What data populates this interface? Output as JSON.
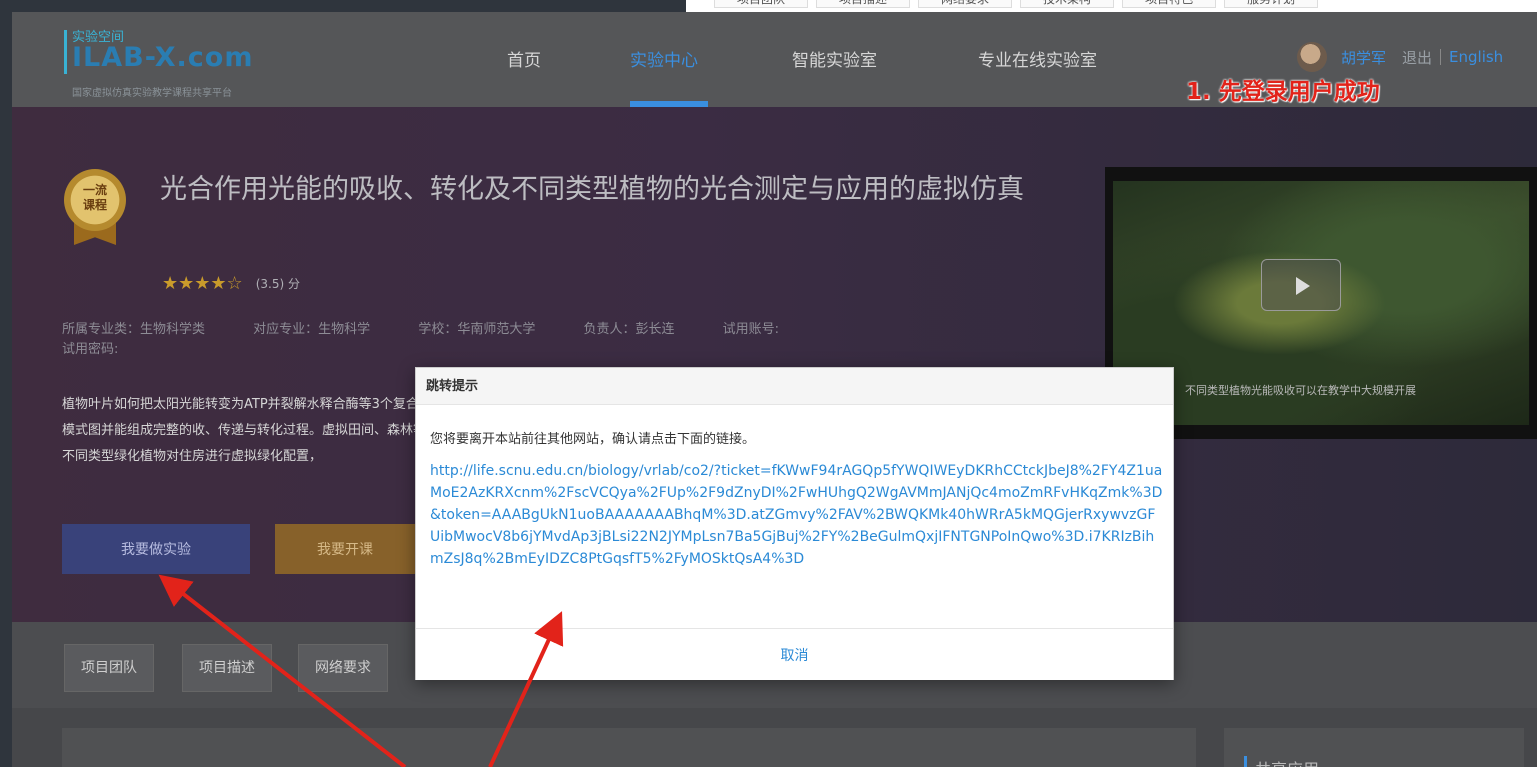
{
  "top_snippet": {
    "tabs": [
      "项目团队",
      "项目描述",
      "网络要求",
      "技术架构",
      "项目特色",
      "服务计划"
    ]
  },
  "header": {
    "logo_cn": "实验空间",
    "logo_en": "ILAB-X.com",
    "logo_sub": "国家虚拟仿真实验教学课程共享平台",
    "nav": [
      "首页",
      "实验中心",
      "智能实验室",
      "专业在线实验室"
    ],
    "active_nav": "实验中心",
    "user_name": "胡学军",
    "logout": "退出",
    "language": "English"
  },
  "annotations": {
    "login_note": "1. 先登录用户成功"
  },
  "hero": {
    "badge": "一流课程",
    "title": "光合作用光能的吸收、转化及不同类型植物的光合测定与应用的虚拟仿真",
    "rating_stars": "★★★★☆",
    "rating": "(3.5) 分",
    "meta": {
      "major_category": "所属专业类：生物科学类",
      "major": "对应专业：生物科学",
      "school": "学校：华南师范大学",
      "leader": "负责人：彭长连",
      "trial_account": "试用账号:",
      "trial_password": "试用密码:"
    },
    "description": "植物叶片如何把太阳光能转变为ATP并裂解水释合酶等3个复合体的三维模式图并能组成完整的收、传递与转化过程。虚拟田间、森林等野外场择不同类型绿化植物对住房进行虚拟绿化配置，",
    "buttons": {
      "do_experiment": "我要做实验",
      "teach": "我要开课"
    },
    "video_caption": "不同类型植物光能吸收可以在教学中大规模开展"
  },
  "tabs": [
    "项目团队",
    "项目描述",
    "网络要求"
  ],
  "sidebar_title": "共享应用",
  "modal": {
    "title": "跳转提示",
    "message": "您将要离开本站前往其他网站，确认请点击下面的链接。",
    "link": "http://life.scnu.edu.cn/biology/vrlab/co2/?ticket=fKWwF94rAGQp5fYWQIWEyDKRhCCtckJbeJ8%2FY4Z1uaMoE2AzKRXcnm%2FscVCQya%2FUp%2F9dZnyDI%2FwHUhgQ2WgAVMmJANjQc4moZmRFvHKqZmk%3D&token=AAABgUkN1uoBAAAAAAABhqM%3D.atZGmvy%2FAV%2BWQKMk40hWRrA5kMQGjerRxywvzGFUibMwocV8b6jYMvdAp3jBLsi22N2JYMpLsn7Ba5GjBuj%2FY%2BeGulmQxjIFNTGNPoInQwo%3D.i7KRIzBihmZsJ8q%2BmEyIDZC8PtGqsfT5%2FyMOSktQsA4%3D",
    "cancel": "取消"
  },
  "colors": {
    "accent_blue": "#3a8fe0",
    "annotation_red": "#e2231a",
    "link_blue": "#2b8ad6"
  }
}
